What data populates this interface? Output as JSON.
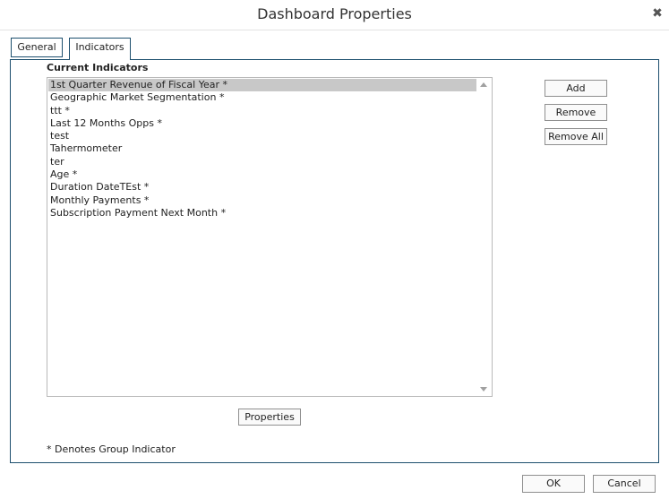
{
  "dialog": {
    "title": "Dashboard Properties",
    "close_icon": "close-icon"
  },
  "tabs": [
    {
      "label": "General",
      "active": false
    },
    {
      "label": "Indicators",
      "active": true
    }
  ],
  "indicators": {
    "section_label": "Current Indicators",
    "items": [
      "1st Quarter Revenue of Fiscal Year *",
      "Geographic Market Segmentation *",
      "ttt *",
      "Last 12 Months Opps *",
      "test",
      "Tahermometer",
      "ter",
      "Age *",
      "Duration DateTEst *",
      "Monthly Payments *",
      "Subscription Payment Next Month *"
    ],
    "selected_index": 0,
    "buttons": {
      "add": "Add",
      "remove": "Remove",
      "remove_all": "Remove All",
      "properties": "Properties"
    },
    "footnote": "* Denotes Group Indicator"
  },
  "footer": {
    "ok": "OK",
    "cancel": "Cancel"
  },
  "colors": {
    "tab_border": "#1d4f6e",
    "selected_row": "#c8c8c8"
  }
}
